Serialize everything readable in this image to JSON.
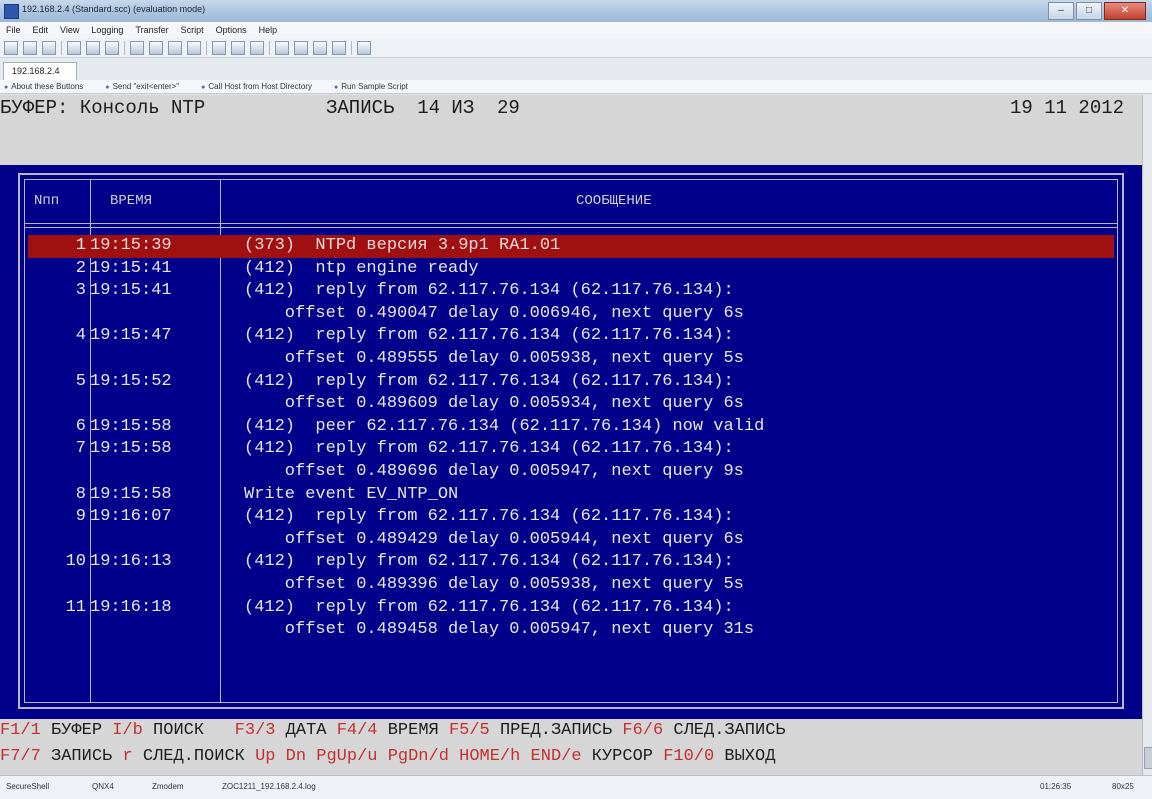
{
  "window": {
    "title": "192.168.2.4 (Standard.scc) (evaluation mode)",
    "controls": [
      "–",
      "□",
      "✕"
    ]
  },
  "menu": [
    "File",
    "Edit",
    "View",
    "Logging",
    "Transfer",
    "Script",
    "Options",
    "Help"
  ],
  "tab": {
    "label": "192.168.2.4"
  },
  "button_bar": [
    "About these Buttons",
    "Send \"exit<enter>\"",
    "Call Host from Host Directory",
    "Run Sample Script"
  ],
  "terminal": {
    "header": {
      "buffer": "БУФЕР: Консоль NTP",
      "record": "ЗАПИСЬ  14 ИЗ  29",
      "date": "19 11 2012"
    },
    "columns": {
      "num": "Nпп",
      "time": "ВРЕМЯ",
      "message": "СООБЩЕНИЕ"
    },
    "rows": [
      {
        "num": "1",
        "time": "19:15:39",
        "msg": "(373)  NTPd версия 3.9p1 RA1.01",
        "selected": true
      },
      {
        "num": "2",
        "time": "19:15:41",
        "msg": "(412)  ntp engine ready"
      },
      {
        "num": "3",
        "time": "19:15:41",
        "msg": "(412)  reply from 62.117.76.134 (62.117.76.134):"
      },
      {
        "num": "",
        "time": "",
        "msg": "    offset 0.490047 delay 0.006946, next query 6s"
      },
      {
        "num": "4",
        "time": "19:15:47",
        "msg": "(412)  reply from 62.117.76.134 (62.117.76.134):"
      },
      {
        "num": "",
        "time": "",
        "msg": "    offset 0.489555 delay 0.005938, next query 5s"
      },
      {
        "num": "5",
        "time": "19:15:52",
        "msg": "(412)  reply from 62.117.76.134 (62.117.76.134):"
      },
      {
        "num": "",
        "time": "",
        "msg": "    offset 0.489609 delay 0.005934, next query 6s"
      },
      {
        "num": "6",
        "time": "19:15:58",
        "msg": "(412)  peer 62.117.76.134 (62.117.76.134) now valid"
      },
      {
        "num": "7",
        "time": "19:15:58",
        "msg": "(412)  reply from 62.117.76.134 (62.117.76.134):"
      },
      {
        "num": "",
        "time": "",
        "msg": "    offset 0.489696 delay 0.005947, next query 9s"
      },
      {
        "num": "8",
        "time": "19:15:58",
        "msg": "Write event EV_NTP_ON"
      },
      {
        "num": "9",
        "time": "19:16:07",
        "msg": "(412)  reply from 62.117.76.134 (62.117.76.134):"
      },
      {
        "num": "",
        "time": "",
        "msg": "    offset 0.489429 delay 0.005944, next query 6s"
      },
      {
        "num": "10",
        "time": "19:16:13",
        "msg": "(412)  reply from 62.117.76.134 (62.117.76.134):"
      },
      {
        "num": "",
        "time": "",
        "msg": "    offset 0.489396 delay 0.005938, next query 5s"
      },
      {
        "num": "11",
        "time": "19:16:18",
        "msg": "(412)  reply from 62.117.76.134 (62.117.76.134):"
      },
      {
        "num": "",
        "time": "",
        "msg": "    offset 0.489458 delay 0.005947, next query 31s"
      }
    ],
    "fkeys_line1": [
      {
        "key": "F1/1",
        "label": " БУФЕР "
      },
      {
        "key": "I/b",
        "label": " ПОИСК   "
      },
      {
        "key": "F3/3",
        "label": " ДАТА "
      },
      {
        "key": "F4/4",
        "label": " ВРЕМЯ "
      },
      {
        "key": "F5/5",
        "label": " ПРЕД.ЗАПИСЬ "
      },
      {
        "key": "F6/6",
        "label": " СЛЕД.ЗАПИСЬ"
      }
    ],
    "fkeys_line2": [
      {
        "key": "F7/7",
        "label": " ЗАПИСЬ "
      },
      {
        "key": "r",
        "label": " СЛЕД.ПОИСК "
      },
      {
        "key": "Up",
        "label": " "
      },
      {
        "key": "Dn",
        "label": " "
      },
      {
        "key": "PgUp/u",
        "label": " "
      },
      {
        "key": "PgDn/d",
        "label": " "
      },
      {
        "key": "HOME/h",
        "label": " "
      },
      {
        "key": "END/e",
        "label": " КУРСОР "
      },
      {
        "key": "F10/0",
        "label": " ВЫХОД"
      }
    ]
  },
  "statusbar": {
    "app": "SecureShell",
    "item2": "QNX4",
    "item3": "Zmodem",
    "file": "ZOC1211_192.168.2.4.log",
    "time": "01:26:35",
    "size": "80x25"
  },
  "colors": {
    "panel_bg": "#00008b",
    "selected_row": "#a01010",
    "fkey": "#c43030",
    "header_bg": "#d6d6d6"
  }
}
